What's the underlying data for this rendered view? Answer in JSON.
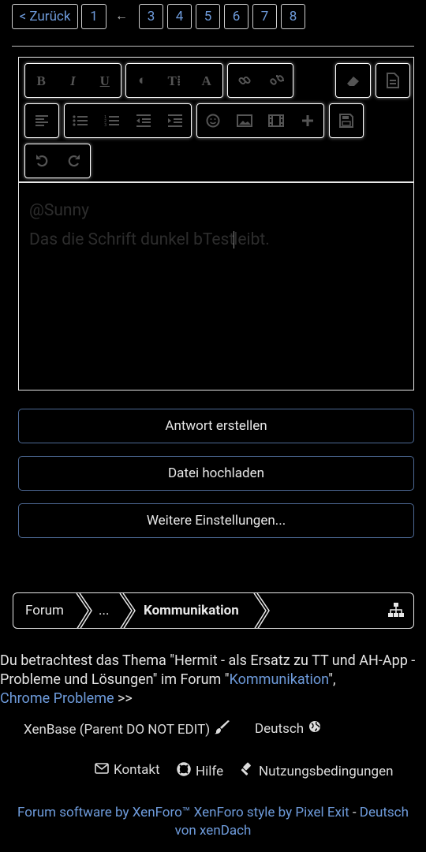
{
  "pagination": {
    "back": "< Zurück",
    "pages": [
      "1",
      "3",
      "4",
      "5",
      "6",
      "7",
      "8"
    ],
    "gap": "←"
  },
  "editor": {
    "line1": "@Sunny",
    "line2_before_caret": "Das die Schrift dunkel bTest",
    "line2_after_caret": "leibt.",
    "toolbar": {
      "row1": [
        [
          "bold-icon",
          "B"
        ],
        [
          "italic-icon",
          "I"
        ],
        [
          "underline-icon",
          "U"
        ],
        [
          "text-color-icon",
          "◐"
        ],
        [
          "font-size-icon",
          "T⁞"
        ],
        [
          "font-family-icon",
          "A"
        ],
        [
          "link-icon",
          "🔗"
        ],
        [
          "unlink-icon",
          "⛓"
        ],
        [
          "remove-format-icon",
          "⌫"
        ],
        [
          "toggle-bbcode-icon",
          "🗎"
        ]
      ],
      "row2": [
        [
          "align-icon",
          "≡"
        ],
        [
          "bullet-list-icon",
          "☰"
        ],
        [
          "numbered-list-icon",
          "☰"
        ],
        [
          "outdent-icon",
          "⇤"
        ],
        [
          "indent-icon",
          "⇥"
        ],
        [
          "smilie-icon",
          "☺"
        ],
        [
          "image-icon",
          "▣"
        ],
        [
          "media-icon",
          "▦"
        ],
        [
          "insert-more-icon",
          "✚"
        ],
        [
          "save-draft-icon",
          "💾"
        ]
      ],
      "row3": [
        [
          "undo-icon",
          "↺"
        ],
        [
          "redo-icon",
          "↻"
        ]
      ]
    }
  },
  "buttons": {
    "reply": "Antwort erstellen",
    "upload": "Datei hochladen",
    "more": "Weitere Einstellungen..."
  },
  "breadcrumb": {
    "items": [
      "Forum",
      "...",
      "Kommunikation"
    ]
  },
  "thread_info": {
    "prefix": "Du betrachtest das Thema \"Hermit - als Ersatz zu TT und AH-App - Probleme und Lösungen\" im Forum \"",
    "forum_link": "Kommunikation",
    "suffix": "\",",
    "extra_link": "Chrome Probleme",
    "more": ">>"
  },
  "style_row": {
    "style": "XenBase (Parent DO NOT EDIT)",
    "language": "Deutsch"
  },
  "footer_links": {
    "contact": "Kontakt",
    "help": "Hilfe",
    "terms": "Nutzungsbedingungen"
  },
  "footer": {
    "line1_a": "Forum software by XenForo™",
    "line1_b": " XenForo style by Pixel Exit",
    "line1_sep": " - ",
    "line1_c": "Deutsch",
    "line2": "von xenDach"
  },
  "colors": {
    "background": "#000000",
    "link": "#6e9bdb",
    "button_border": "#4e6a96"
  }
}
